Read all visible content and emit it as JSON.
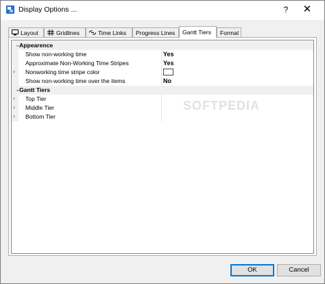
{
  "window": {
    "title": "Display Options ...",
    "help_label": "?",
    "close_label": "✕"
  },
  "tabs": [
    {
      "label": "Layout",
      "icon": "layout-icon"
    },
    {
      "label": "Gridlines",
      "icon": "gridlines-icon"
    },
    {
      "label": "Time Links",
      "icon": "link-icon"
    },
    {
      "label": "Progress Lines"
    },
    {
      "label": "Gantt Tiers",
      "active": true
    },
    {
      "label": "Format"
    }
  ],
  "grid": {
    "sections": [
      {
        "label": "Appearence",
        "rows": [
          {
            "name": "Show non-working time",
            "value": "Yes"
          },
          {
            "name": "Approximate Non-Working Time Stripes",
            "value": "Yes"
          },
          {
            "name": "Nonworking time stripe color",
            "value": "",
            "swatch": "#ffffff"
          },
          {
            "name": "Show non-working time over the items",
            "value": "No"
          }
        ]
      },
      {
        "label": "Gantt Tiers",
        "rows": [
          {
            "name": "Top Tier",
            "value": ""
          },
          {
            "name": "Middle Tier",
            "value": ""
          },
          {
            "name": "Bottom Tier",
            "value": ""
          }
        ]
      }
    ],
    "watermark": "SOFTPEDIA"
  },
  "buttons": {
    "ok": "OK",
    "cancel": "Cancel"
  },
  "colors": {
    "accent": "#0078d7",
    "category_bg": "#f0f0f0"
  }
}
